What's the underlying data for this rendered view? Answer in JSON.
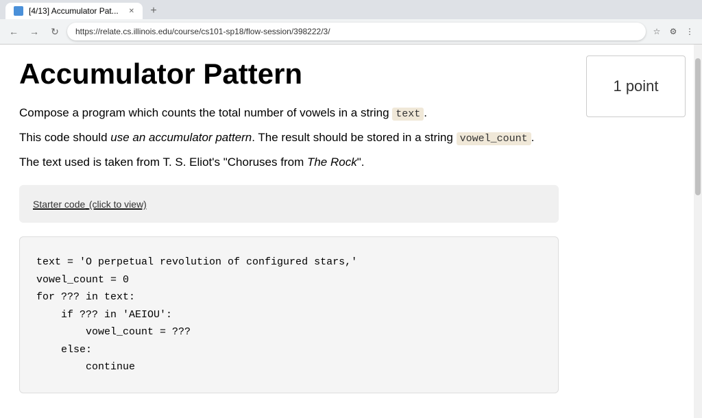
{
  "browser": {
    "tab_title": "[4/13] Accumulator Pat...",
    "url": "https://relate.cs.illinois.edu/course/cs101-sp18/flow-session/398222/3/",
    "new_tab_icon": "+",
    "back_icon": "←",
    "forward_icon": "→",
    "refresh_icon": "↻",
    "lock_icon": "🔒"
  },
  "points_box": {
    "label": "1 point"
  },
  "page": {
    "title": "Accumulator Pattern",
    "description_1_pre": "Compose a program which counts the total number of vowels in a string ",
    "description_1_code": "text",
    "description_1_post": ".",
    "description_2_pre": "This code should ",
    "description_2_em": "use an accumulator pattern",
    "description_2_mid": ". The result should be stored in a string ",
    "description_2_code": "vowel_count",
    "description_2_post": ".",
    "description_3": "The text used is taken from T. S. Eliot's \"Choruses from The Rock\".",
    "starter_code_label": "Starter code",
    "starter_code_hint": "(click to view)",
    "code_block": "text = 'O perpetual revolution of configured stars,'\nvowel_count = 0\nfor ??? in text:\n    if ??? in 'AEIOU':\n        vowel_count = ???\n    else:\n        continue"
  }
}
